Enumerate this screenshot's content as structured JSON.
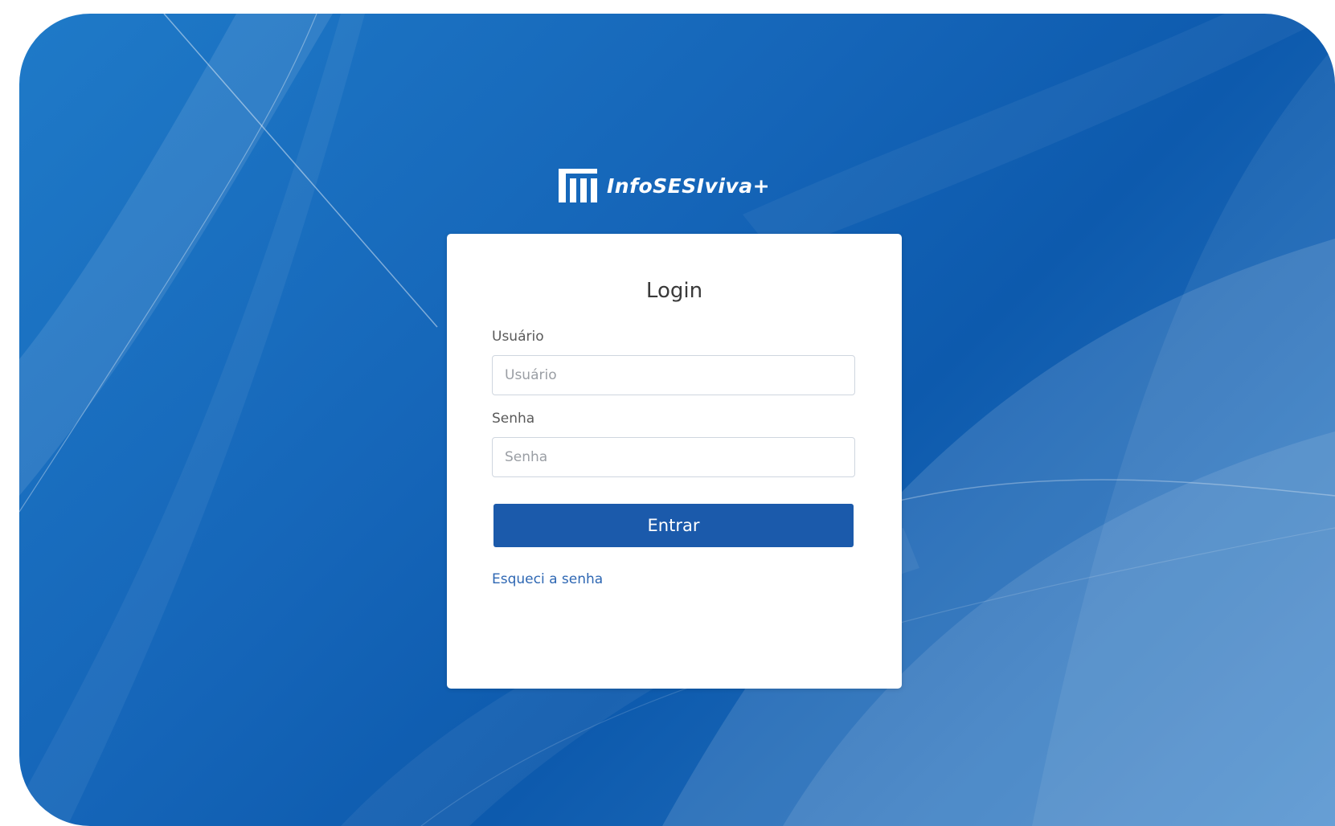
{
  "brand": {
    "name": "InfoSESIviva+",
    "logo_icon": "building-columns-icon"
  },
  "login": {
    "title": "Login",
    "username": {
      "label": "Usuário",
      "placeholder": "Usuário",
      "value": ""
    },
    "password": {
      "label": "Senha",
      "placeholder": "Senha",
      "value": ""
    },
    "submit_label": "Entrar",
    "forgot_label": "Esqueci a senha"
  },
  "colors": {
    "background": "#1565b8",
    "primary_button": "#1b5aab",
    "link": "#2e67b3",
    "card": "#ffffff"
  }
}
